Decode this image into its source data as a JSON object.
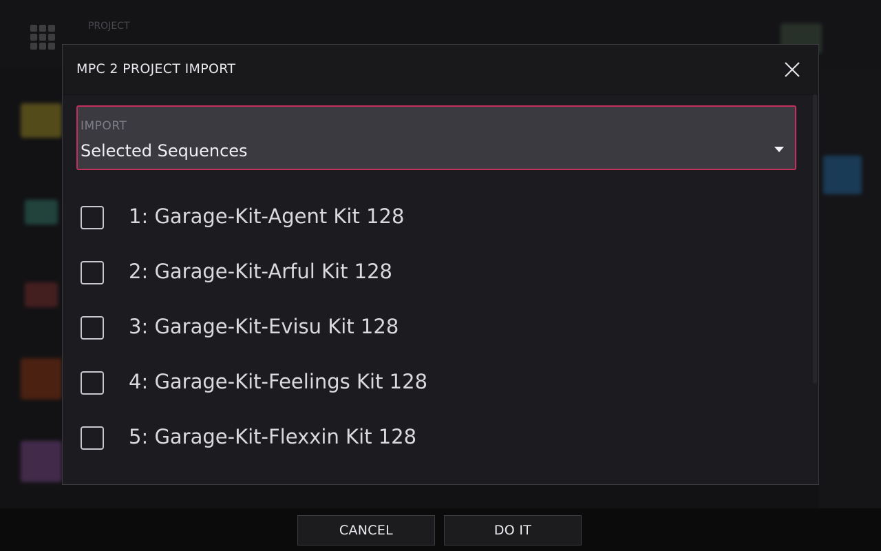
{
  "background": {
    "app_title": "PROJECT",
    "accent_color": "#c2315c"
  },
  "dialog": {
    "title": "MPC 2 PROJECT IMPORT",
    "close_icon": "close-icon",
    "import_dropdown": {
      "label": "IMPORT",
      "value": "Selected Sequences"
    },
    "sequences": [
      {
        "label": "1: Garage-Kit-Agent Kit 128",
        "checked": false
      },
      {
        "label": "2: Garage-Kit-Arful Kit 128",
        "checked": false
      },
      {
        "label": "3: Garage-Kit-Evisu Kit 128",
        "checked": false
      },
      {
        "label": "4: Garage-Kit-Feelings Kit 128",
        "checked": false
      },
      {
        "label": "5: Garage-Kit-Flexxin Kit 128",
        "checked": false
      }
    ]
  },
  "footer": {
    "cancel_label": "CANCEL",
    "do_it_label": "DO IT"
  }
}
